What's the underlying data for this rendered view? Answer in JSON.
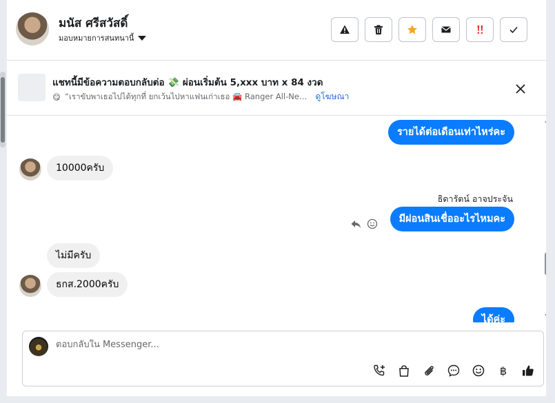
{
  "header": {
    "contact_name": "มนัส ศรีสวัสดิ์",
    "assignee_label": "มอบหมายการสนทนานี้",
    "actions": [
      {
        "name": "report-button",
        "icon": "warning-icon"
      },
      {
        "name": "delete-button",
        "icon": "trash-icon"
      },
      {
        "name": "star-button",
        "icon": "star-icon",
        "color": "#f5a623"
      },
      {
        "name": "mark-unread-button",
        "icon": "envelope-icon"
      },
      {
        "name": "flag-important-button",
        "icon": "exclamation-icon",
        "color": "#e03c31"
      },
      {
        "name": "mark-done-button",
        "icon": "check-icon"
      }
    ]
  },
  "banner": {
    "title": "แชทนี้มีข้อความตอบกลับต่อ 💸 ผ่อนเริ่มต้น 5,xxx บาท x 84 งวด",
    "emoji": "😋",
    "preview": "“เราขับพาเธอไปได้ทุกที่ ยกเว้นไปหาแฟนเก่าเธอ 🚘 Ranger All-Ne…",
    "link": "ดูโฆษณา"
  },
  "messages": [
    {
      "dir": "out",
      "text": "รายได้ต่อเดือนเท่าไหร่คะ"
    },
    {
      "dir": "in",
      "text": "10000ครับ"
    },
    {
      "dir": "out",
      "sender": "ธิดารัตน์ อาจประจัน",
      "text": "มีผ่อนสินเชื่ออะไรไหมคะ"
    },
    {
      "dir": "in",
      "text": "ไม่มีครับ"
    },
    {
      "dir": "in",
      "text": "ธกส.2000ครับ"
    },
    {
      "dir": "out",
      "text": "ได้ค่ะ"
    }
  ],
  "composer": {
    "placeholder": "ตอบกลับใน Messenger...",
    "value": "",
    "tools": [
      "call-add-icon",
      "shopping-bag-icon",
      "paperclip-icon",
      "chat-bubble-icon",
      "smile-icon",
      "baht-icon",
      "thumbs-up-icon"
    ],
    "baht_symbol": "฿"
  },
  "colors": {
    "outgoing_bubble": "#0a7cff",
    "incoming_bubble": "#f0f0f0",
    "link": "#216fdb"
  }
}
